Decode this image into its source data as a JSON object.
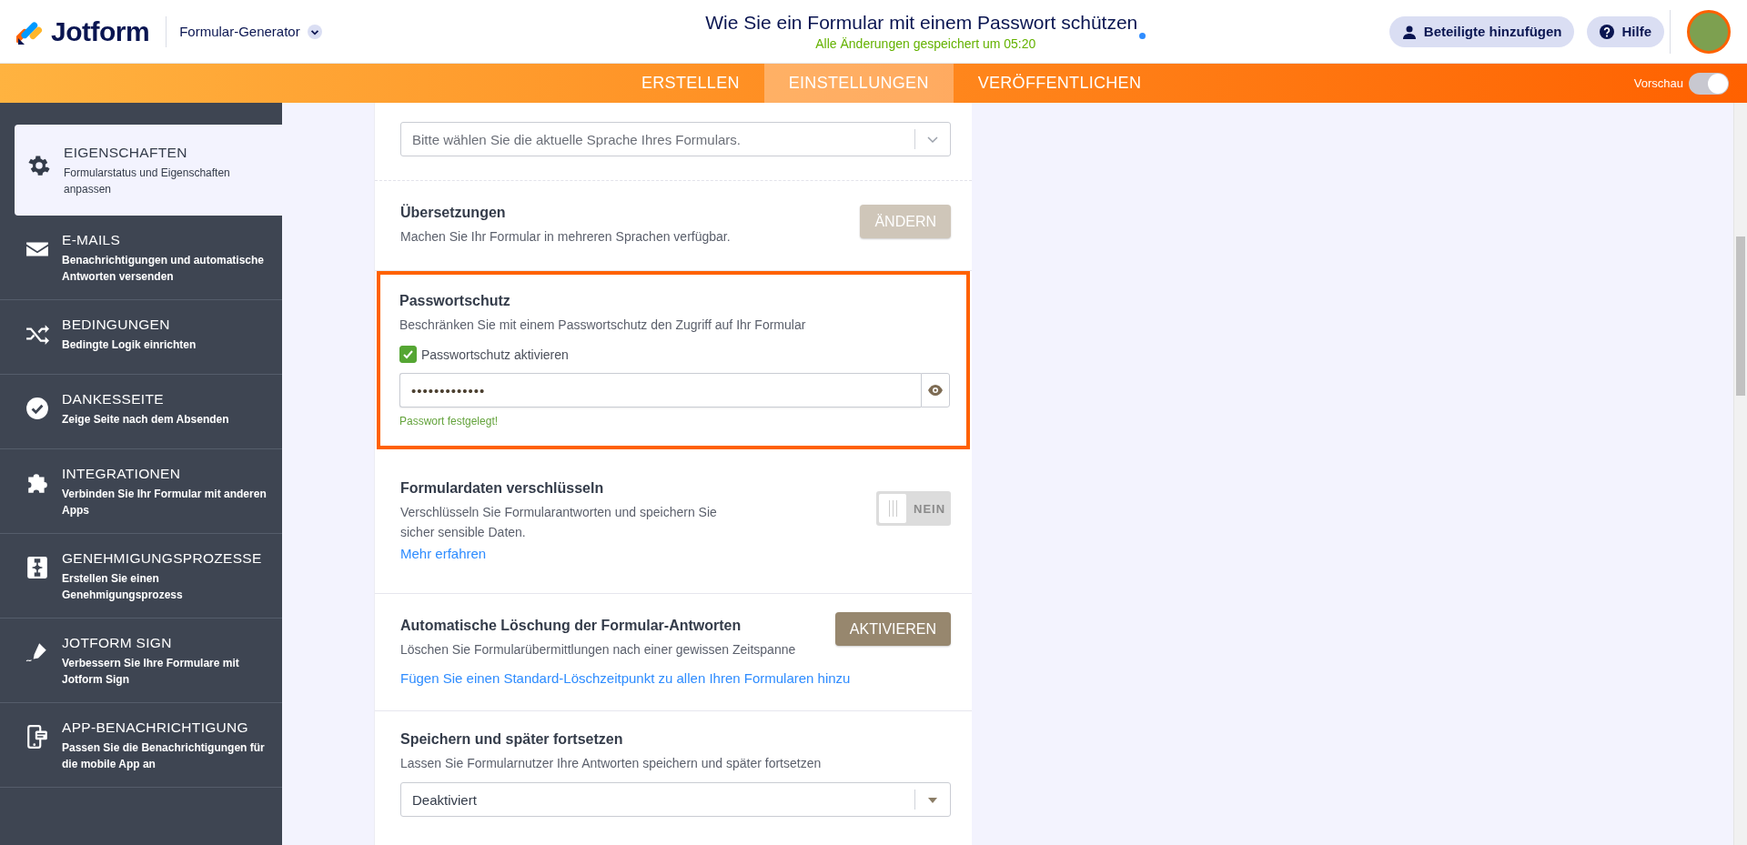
{
  "header": {
    "logo_text": "Jotform",
    "builder_menu": "Formular-Generator",
    "title": "Wie Sie ein Formular mit einem Passwort schützen",
    "save_status": "Alle Änderungen gespeichert um 05:20",
    "buttons": [
      {
        "kind": "people",
        "label": "Beteiligte hinzufügen"
      },
      {
        "kind": "help",
        "label": "Hilfe"
      }
    ]
  },
  "nav": {
    "tabs": [
      {
        "label": "ERSTELLEN",
        "selected": false
      },
      {
        "label": "EINSTELLUNGEN",
        "selected": true
      },
      {
        "label": "VERÖFFENTLICHEN",
        "selected": false
      }
    ],
    "preview": {
      "label": "Vorschau",
      "on": true
    }
  },
  "sidebar": {
    "items": [
      {
        "kind": "gear",
        "title": "EIGENSCHAFTEN",
        "description": "Formularstatus und Eigenschaften anpassen",
        "selected": true
      },
      {
        "kind": "mail",
        "title": "E-MAILS",
        "description": "Benachrichtigungen und automatische Antworten versenden",
        "selected": false
      },
      {
        "kind": "shuffle",
        "title": "BEDINGUNGEN",
        "description": "Bedingte Logik einrichten",
        "selected": false
      },
      {
        "kind": "check",
        "title": "DANKESSEITE",
        "description": "Zeige Seite nach dem Absenden",
        "selected": false
      },
      {
        "kind": "puzzle",
        "title": "INTEGRATIONEN",
        "description": "Verbinden Sie Ihr Formular mit anderen Apps",
        "selected": false
      },
      {
        "kind": "flow",
        "title": "GENEHMIGUNGSPROZESSE",
        "description": "Erstellen Sie einen Genehmigungsprozess",
        "selected": false
      },
      {
        "kind": "pen",
        "title": "JOTFORM SIGN",
        "description": "Verbessern Sie Ihre Formulare mit Jotform Sign",
        "selected": false
      },
      {
        "kind": "phone",
        "title": "APP-BENACHRICHTIGUNG",
        "description": "Passen Sie die Benachrichtigungen für die mobile App an",
        "selected": false
      }
    ]
  },
  "sections": [
    {
      "kind": "select",
      "placeholder": "Bitte wählen Sie die aktuelle Sprache Ihres Formulars."
    },
    {
      "kind": "action",
      "title": "Übersetzungen",
      "description": "Machen Sie Ihr Formular in mehreren Sprachen verfügbar.",
      "button": {
        "label": "ÄNDERN",
        "disabled": true
      }
    },
    {
      "kind": "password",
      "highlighted": true,
      "title": "Passwortschutz",
      "description": "Beschränken Sie mit einem Passwortschutz den Zugriff auf Ihr Formular",
      "checkbox": {
        "label": "Passwortschutz aktivieren",
        "checked": true
      },
      "value": "•••••••••••••",
      "hint": "Passwort festgelegt!"
    },
    {
      "kind": "toggle",
      "title": "Formulardaten verschlüsseln",
      "description": "Verschlüsseln Sie Formularantworten und speichern Sie sicher sensible Daten.",
      "link": "Mehr erfahren",
      "toggle": {
        "label": "NEIN",
        "on": false
      }
    },
    {
      "kind": "action",
      "title": "Automatische Löschung der Formular-Antworten",
      "description": "Löschen Sie Formularübermittlungen nach einer gewissen Zeitspanne",
      "link": "Fügen Sie einen Standard-Löschzeitpunkt zu allen Ihren Formularen hinzu",
      "button": {
        "label": "AKTIVIEREN",
        "disabled": false
      }
    },
    {
      "kind": "select",
      "title": "Speichern und später fortsetzen",
      "description": "Lassen Sie Formularnutzer Ihre Antworten speichern und später fortsetzen",
      "value": "Deaktiviert"
    }
  ]
}
